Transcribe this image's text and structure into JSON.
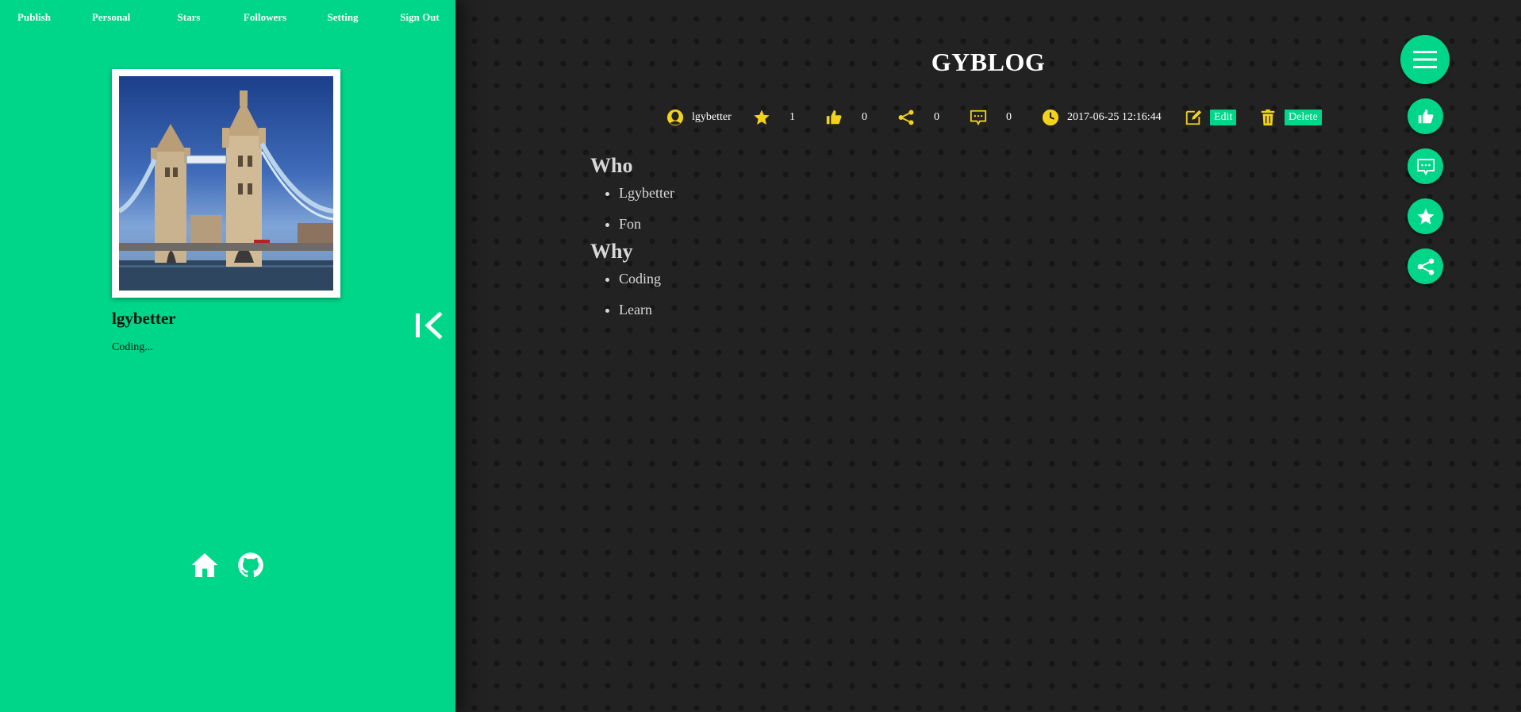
{
  "nav": {
    "items": [
      {
        "label": "Publish"
      },
      {
        "label": "Personal"
      },
      {
        "label": "Stars"
      },
      {
        "label": "Followers"
      },
      {
        "label": "Setting"
      },
      {
        "label": "Sign Out"
      }
    ]
  },
  "profile": {
    "name": "lgybetter",
    "bio": "Coding..."
  },
  "post": {
    "title": "GYBLOG",
    "author": "lgybetter",
    "stars": "1",
    "likes": "0",
    "shares": "0",
    "comments": "0",
    "date": "2017-06-25 12:16:44",
    "edit_label": "Edit",
    "delete_label": "Delete",
    "sections": [
      {
        "heading": "Who",
        "items": [
          "Lgybetter",
          "Fon"
        ]
      },
      {
        "heading": "Why",
        "items": [
          "Coding",
          "Learn"
        ]
      }
    ]
  },
  "icons": {
    "author": "user-icon",
    "stars": "star-icon",
    "likes": "thumbs-up-icon",
    "shares": "share-icon",
    "comments": "comment-icon",
    "date": "clock-icon",
    "edit": "edit-icon",
    "delete": "trash-icon",
    "home": "home-icon",
    "github": "github-icon",
    "menu": "menu-icon",
    "collapse": "collapse-icon"
  },
  "colors": {
    "accent": "#00d68a",
    "icon_yellow": "#f2d31b",
    "background": "#222222"
  }
}
